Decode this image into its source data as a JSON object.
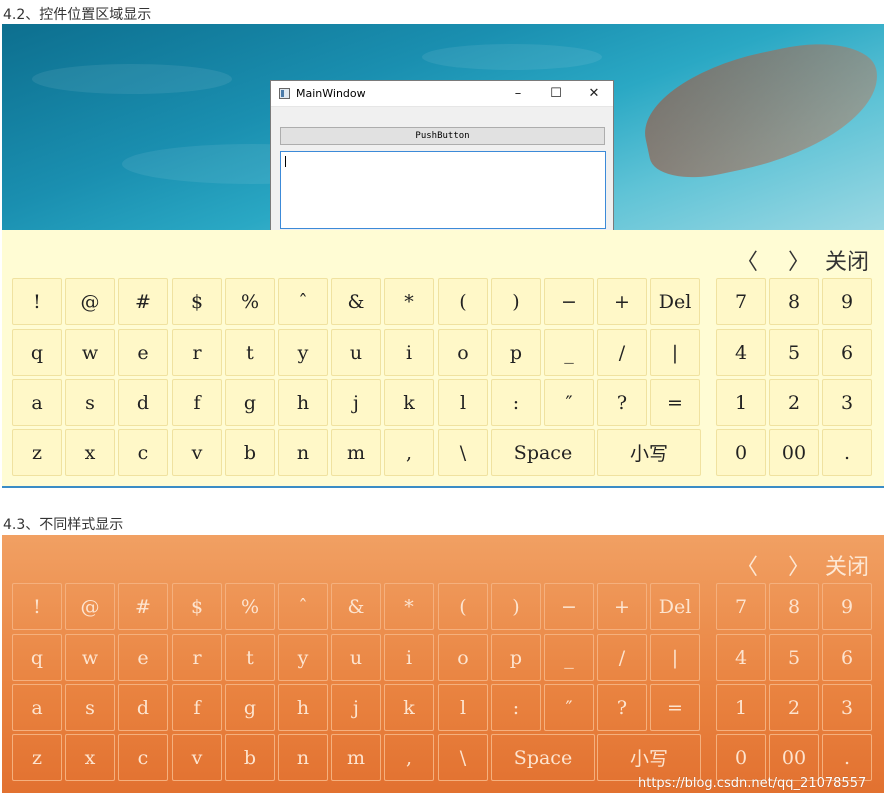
{
  "section1_title": "4.2、控件位置区域显示",
  "section2_title": "4.3、不同样式显示",
  "window": {
    "title": "MainWindow",
    "minimize": "–",
    "maximize": "☐",
    "close": "✕",
    "push_button": "PushButton"
  },
  "keyboard_nav": {
    "prev": "〈",
    "next": "〉",
    "close": "关闭"
  },
  "rows": [
    {
      "main": [
        "!",
        "@",
        "#",
        "$",
        "%",
        "ˆ",
        "&",
        "*",
        "(",
        ")",
        "−",
        "+",
        "Del"
      ],
      "num": [
        "7",
        "8",
        "9"
      ]
    },
    {
      "main": [
        "q",
        "w",
        "e",
        "r",
        "t",
        "y",
        "u",
        "i",
        "o",
        "p",
        "_",
        "/",
        "|"
      ],
      "num": [
        "4",
        "5",
        "6"
      ]
    },
    {
      "main": [
        "a",
        "s",
        "d",
        "f",
        "g",
        "h",
        "j",
        "k",
        "l",
        ":",
        "″",
        "?",
        "="
      ],
      "num": [
        "1",
        "2",
        "3"
      ]
    },
    {
      "main": [
        "z",
        "x",
        "c",
        "v",
        "b",
        "n",
        "m",
        ",",
        "\\",
        "Space",
        "小写"
      ],
      "num": [
        "0",
        "00",
        "."
      ]
    }
  ],
  "watermark": "https://blog.csdn.net/qq_21078557",
  "colors": {
    "theme1_bg": "#fffcd4",
    "theme2_bg": "#e98340"
  }
}
